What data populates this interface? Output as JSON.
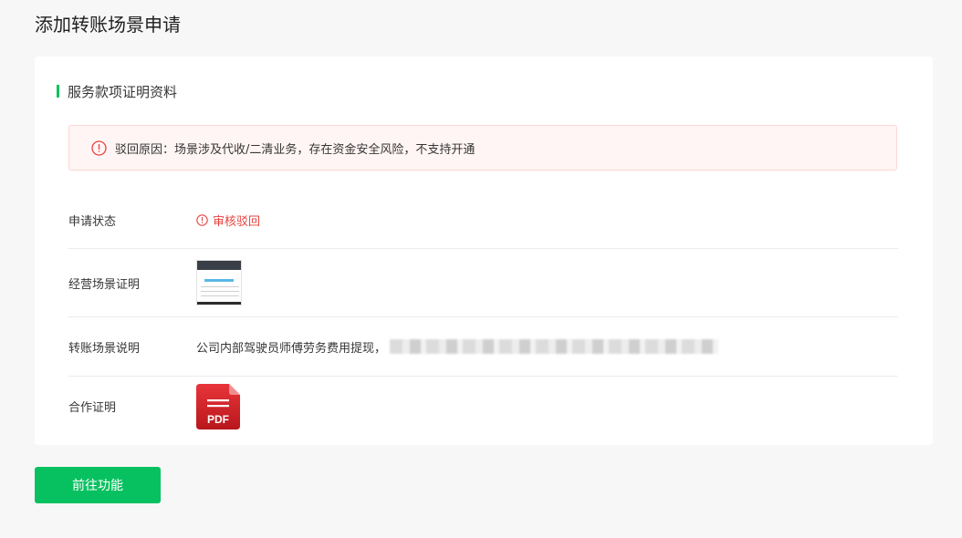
{
  "page": {
    "title": "添加转账场景申请"
  },
  "section": {
    "title": "服务款项证明资料"
  },
  "alert": {
    "icon": "exclamation-circle-icon",
    "text": "驳回原因：场景涉及代收/二清业务，存在资金安全风险，不支持开通"
  },
  "rows": {
    "status": {
      "label": "申请状态",
      "value": "审核驳回",
      "icon": "exclamation-circle-icon",
      "color": "#e64340"
    },
    "scene_proof": {
      "label": "经营场景证明",
      "value_type": "image-thumbnail"
    },
    "scene_desc": {
      "label": "转账场景说明",
      "value": "公司内部驾驶员师傅劳务费用提现，"
    },
    "coop_proof": {
      "label": "合作证明",
      "file_icon": "pdf-file-icon",
      "file_badge": "PDF"
    }
  },
  "action": {
    "button_label": "前往功能",
    "color": "#07c160"
  }
}
